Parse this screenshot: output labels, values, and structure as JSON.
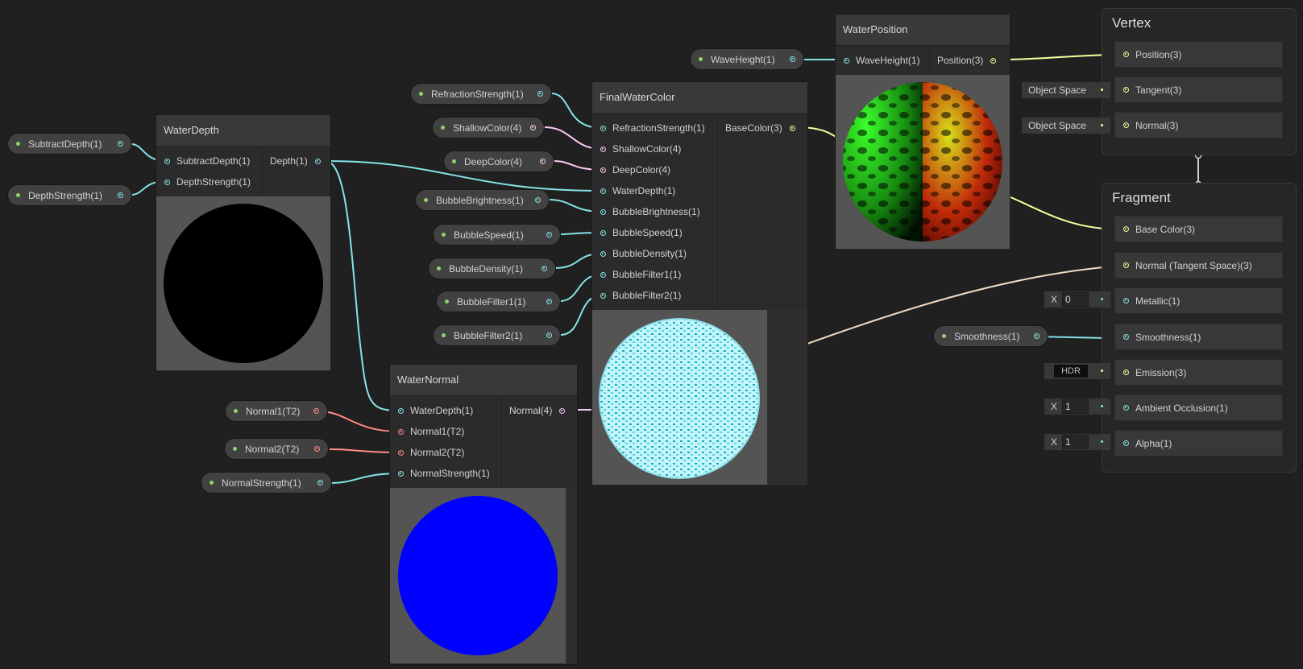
{
  "colors": {
    "float": "#84e4e7",
    "vector4": "#fbcbf4",
    "vector3": "#f6ff9a",
    "texture2d": "#ff8b8b",
    "property_dot": "#8fd46c"
  },
  "nodes": {
    "water_depth": {
      "title": "WaterDepth",
      "inputs": [
        "SubtractDepth(1)",
        "DepthStrength(1)"
      ],
      "outputs": [
        "Depth(1)"
      ]
    },
    "water_normal": {
      "title": "WaterNormal",
      "inputs": [
        "WaterDepth(1)",
        "Normal1(T2)",
        "Normal2(T2)",
        "NormalStrength(1)"
      ],
      "outputs": [
        "Normal(4)"
      ]
    },
    "final_water_color": {
      "title": "FinalWaterColor",
      "inputs": [
        "RefractionStrength(1)",
        "ShallowColor(4)",
        "DeepColor(4)",
        "WaterDepth(1)",
        "BubbleBrightness(1)",
        "BubbleSpeed(1)",
        "BubbleDensity(1)",
        "BubbleFilter1(1)",
        "BubbleFilter2(1)"
      ],
      "outputs": [
        "BaseColor(3)"
      ]
    },
    "water_position": {
      "title": "WaterPosition",
      "inputs": [
        "WaveHeight(1)"
      ],
      "outputs": [
        "Position(3)"
      ]
    }
  },
  "properties": {
    "subtract_depth": "SubtractDepth(1)",
    "depth_strength": "DepthStrength(1)",
    "refraction_strength": "RefractionStrength(1)",
    "shallow_color": "ShallowColor(4)",
    "deep_color": "DeepColor(4)",
    "bubble_brightness": "BubbleBrightness(1)",
    "bubble_speed": "BubbleSpeed(1)",
    "bubble_density": "BubbleDensity(1)",
    "bubble_filter1": "BubbleFilter1(1)",
    "bubble_filter2": "BubbleFilter2(1)",
    "normal1": "Normal1(T2)",
    "normal2": "Normal2(T2)",
    "normal_strength": "NormalStrength(1)",
    "wave_height": "WaveHeight(1)",
    "smoothness": "Smoothness(1)"
  },
  "vertex": {
    "title": "Vertex",
    "slots": [
      "Position(3)",
      "Tangent(3)",
      "Normal(3)"
    ],
    "tangent_space": "Object Space",
    "normal_space": "Object Space"
  },
  "fragment": {
    "title": "Fragment",
    "slots": [
      "Base Color(3)",
      "Normal (Tangent Space)(3)",
      "Metallic(1)",
      "Smoothness(1)",
      "Emission(3)",
      "Ambient Occlusion(1)",
      "Alpha(1)"
    ],
    "metallic": {
      "axis": "X",
      "value": "0"
    },
    "emission": "HDR",
    "ambient_occlusion": {
      "axis": "X",
      "value": "1"
    },
    "alpha": {
      "axis": "X",
      "value": "1"
    }
  }
}
